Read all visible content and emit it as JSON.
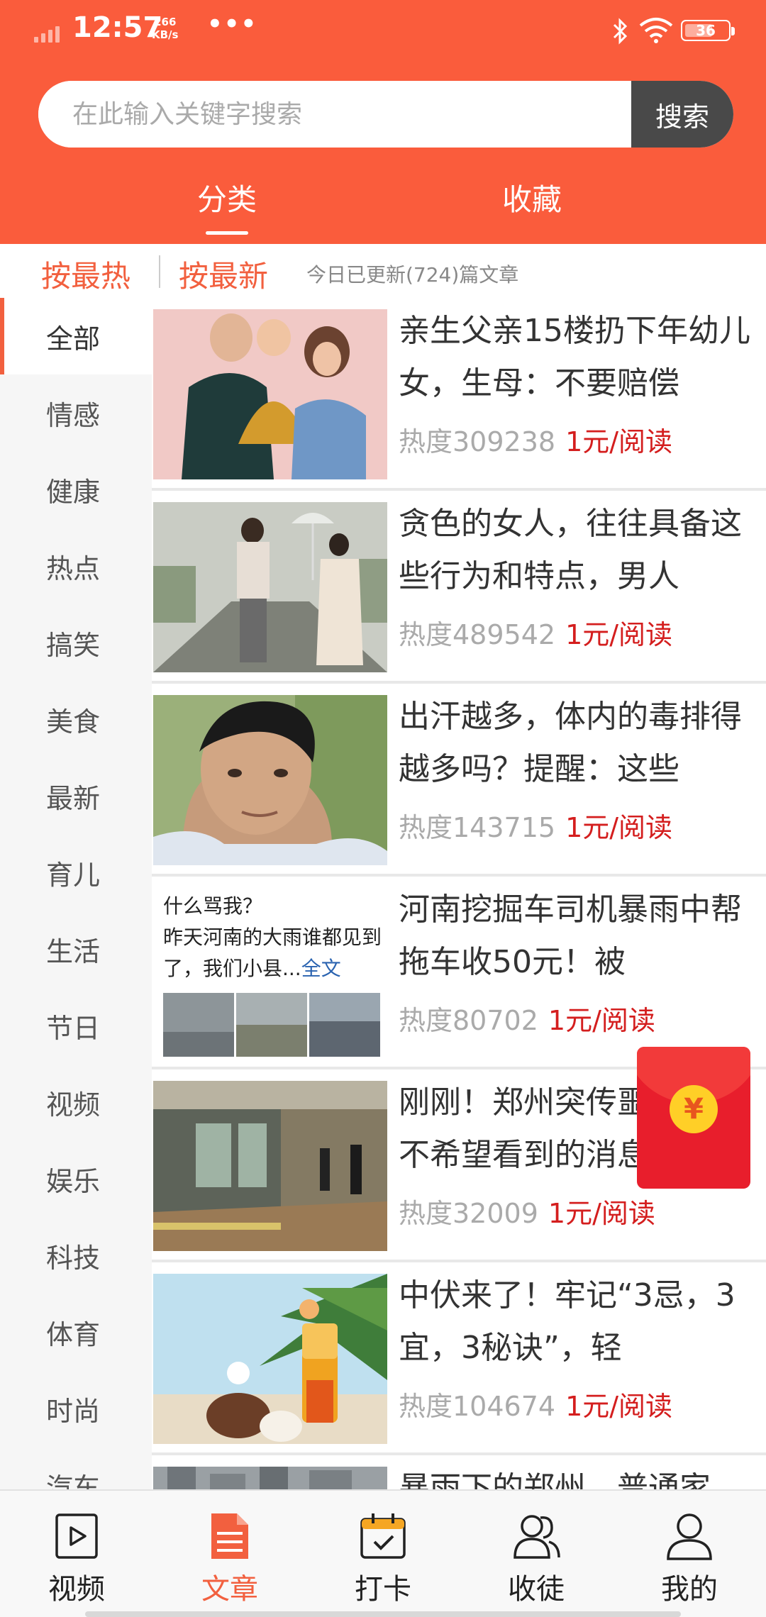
{
  "status": {
    "time": "12:57",
    "speed_value": "266",
    "speed_unit": "KB/s",
    "battery": "36"
  },
  "search": {
    "placeholder": "在此输入关键字搜索",
    "button": "搜索"
  },
  "top_tabs": [
    {
      "label": "分类",
      "active": true
    },
    {
      "label": "收藏",
      "active": false
    }
  ],
  "sort": {
    "hot": "按最热",
    "new": "按最新",
    "update_text": "今日已更新(724)篇文章"
  },
  "categories": [
    "全部",
    "情感",
    "健康",
    "热点",
    "搞笑",
    "美食",
    "最新",
    "育儿",
    "生活",
    "节日",
    "视频",
    "娱乐",
    "科技",
    "体育",
    "时尚",
    "汽车"
  ],
  "articles": [
    {
      "title": "亲生父亲15楼扔下年幼儿女，生母：不要赔偿",
      "heat": "热度309238",
      "price": "1元/阅读"
    },
    {
      "title": "贪色的女人，往往具备这些行为和特点，男人",
      "heat": "热度489542",
      "price": "1元/阅读"
    },
    {
      "title": "出汗越多，体内的毒排得越多吗？提醒：这些",
      "heat": "热度143715",
      "price": "1元/阅读"
    },
    {
      "title": "河南挖掘车司机暴雨中帮拖车收50元！被",
      "heat": "热度80702",
      "price": "1元/阅读",
      "thumb_text": "什么骂我？\n昨天河南的大雨谁都见到了，我们小县...",
      "thumb_link": "全文"
    },
    {
      "title": "刚刚！郑州突传噩耗，最不希望看到的消息还是来了",
      "heat": "热度32009",
      "price": "1元/阅读"
    },
    {
      "title": "中伏来了！牢记“3忌，3宜，3秘诀”，轻",
      "heat": "热度104674",
      "price": "1元/阅读"
    },
    {
      "title": "暴雨下的郑州，普通家",
      "heat": "",
      "price": ""
    }
  ],
  "redpacket": {
    "symbol": "¥"
  },
  "bottom_nav": [
    {
      "label": "视频",
      "icon": "video-icon",
      "active": false
    },
    {
      "label": "文章",
      "icon": "article-icon",
      "active": true
    },
    {
      "label": "打卡",
      "icon": "calendar-checkin-icon",
      "active": false
    },
    {
      "label": "收徒",
      "icon": "users-icon",
      "active": false
    },
    {
      "label": "我的",
      "icon": "user-icon",
      "active": false
    }
  ],
  "colors": {
    "brand": "#fa5c3c",
    "accent": "#f2603f",
    "price": "#d41e1e",
    "search_button": "#494949"
  }
}
